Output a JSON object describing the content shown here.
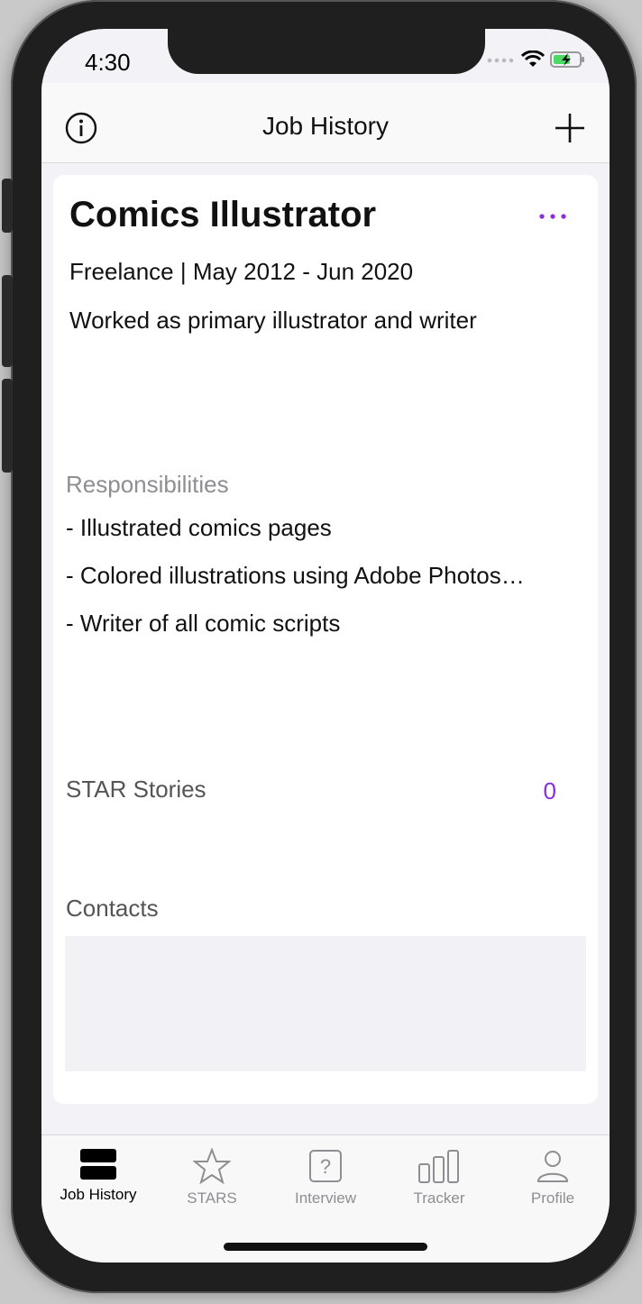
{
  "status": {
    "time": "4:30"
  },
  "nav": {
    "title": "Job History"
  },
  "job": {
    "title": "Comics Illustrator",
    "meta": "Freelance | May 2012 - Jun 2020",
    "summary": "Worked as primary illustrator and writer"
  },
  "responsibilities": {
    "label": "Responsibilities",
    "items": [
      "- Illustrated comics pages",
      "- Colored illustrations using Adobe Photos…",
      "- Writer of all comic scripts"
    ]
  },
  "star_stories": {
    "label": "STAR Stories",
    "count": "0"
  },
  "contacts": {
    "label": "Contacts"
  },
  "tabbar": {
    "items": [
      {
        "label": "Job History",
        "icon": "job-history-icon",
        "active": true
      },
      {
        "label": "STARS",
        "icon": "star-icon",
        "active": false
      },
      {
        "label": "Interview",
        "icon": "question-box-icon",
        "active": false
      },
      {
        "label": "Tracker",
        "icon": "bar-chart-icon",
        "active": false
      },
      {
        "label": "Profile",
        "icon": "person-icon",
        "active": false
      }
    ]
  },
  "colors": {
    "accent": "#8a2be2",
    "inactive_tab": "#8e8e93",
    "secondary_label": "#8e8e93"
  }
}
